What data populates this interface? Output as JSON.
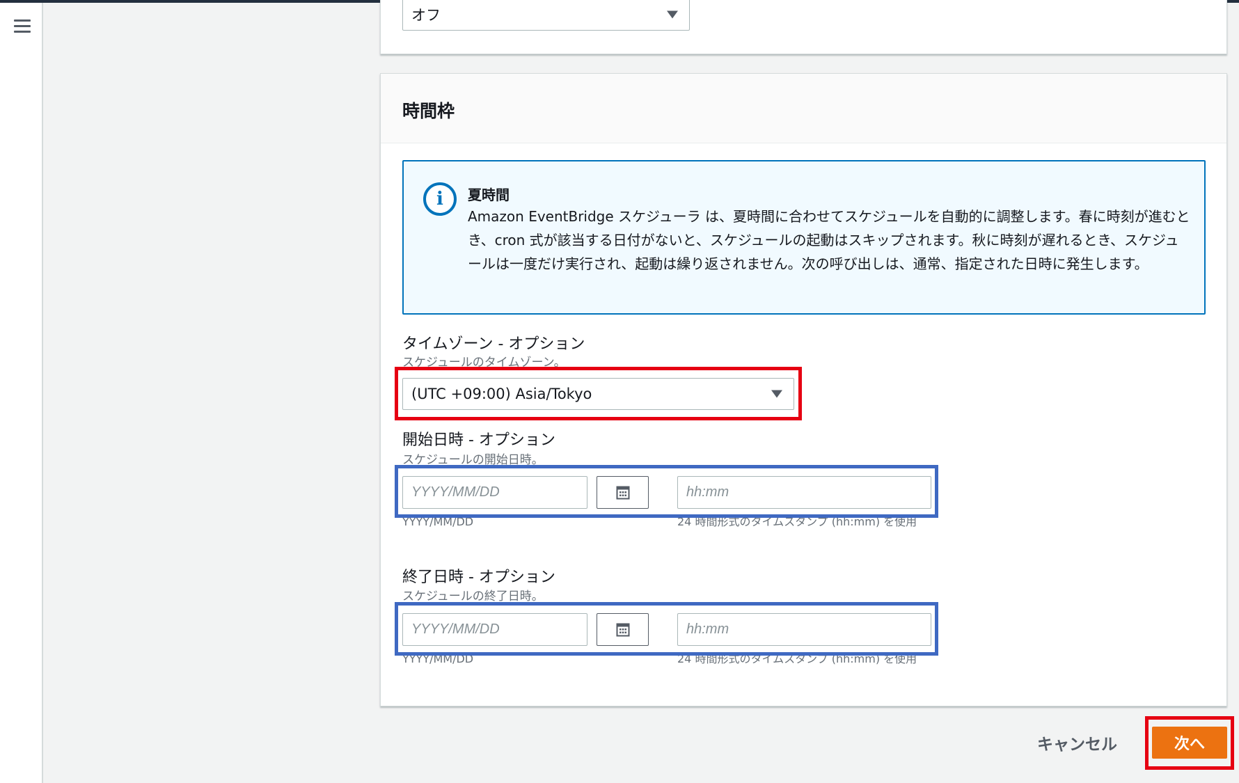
{
  "nav": {
    "menu_icon": "hamburger-menu-icon"
  },
  "previous_section": {
    "select_value": "オフ"
  },
  "section": {
    "title": "時間枠",
    "info": {
      "icon": "info-icon",
      "title": "夏時間",
      "text": "Amazon EventBridge スケジューラ は、夏時間に合わせてスケジュールを自動的に調整します。春に時刻が進むとき、cron 式が該当する日付がないと、スケジュールの起動はスキップされます。秋に時刻が遅れるとき、スケジュールは一度だけ実行され、起動は繰り返されません。次の呼び出しは、通常、指定された日時に発生します。"
    },
    "timezone": {
      "label": "タイムゾーン - オプション",
      "description": "スケジュールのタイムゾーン。",
      "value": "(UTC +09:00) Asia/Tokyo"
    },
    "start": {
      "label": "開始日時 - オプション",
      "description": "スケジュールの開始日時。",
      "date_placeholder": "YYYY/MM/DD",
      "time_placeholder": "hh:mm",
      "date_hint": "YYYY/MM/DD",
      "time_hint": "24 時間形式のタイムスタンプ (hh:mm) を使用"
    },
    "end": {
      "label": "終了日時 - オプション",
      "description": "スケジュールの終了日時。",
      "date_placeholder": "YYYY/MM/DD",
      "time_placeholder": "hh:mm",
      "date_hint": "YYYY/MM/DD",
      "time_hint": "24 時間形式のタイムスタンプ (hh:mm) を使用"
    }
  },
  "footer": {
    "cancel_label": "キャンセル",
    "next_label": "次へ"
  },
  "colors": {
    "primary_button": "#ec7211",
    "info_border": "#0073bb",
    "highlight_red": "#e60012",
    "highlight_blue": "#3f69c2"
  }
}
